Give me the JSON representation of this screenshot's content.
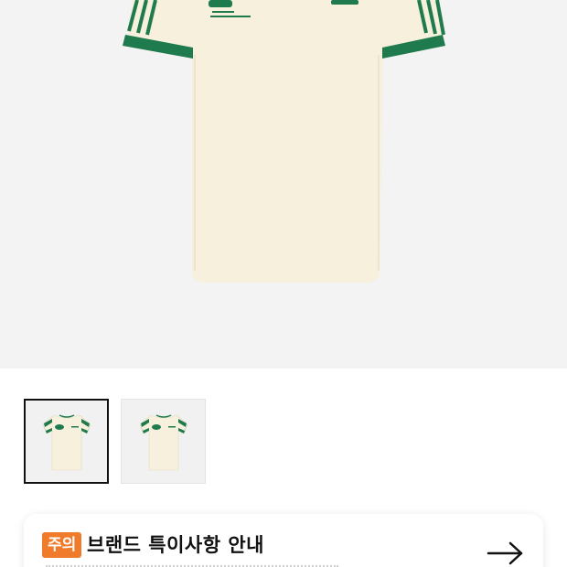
{
  "product": {
    "name": "",
    "colors": {
      "body": "#f6f0dc",
      "trim": "#1f7a4d",
      "background": "#f3f3f3"
    }
  },
  "thumbnails": [
    {
      "selected": true
    },
    {
      "selected": false
    }
  ],
  "notice": {
    "badge": "주의",
    "title": "브랜드 특이사항 안내",
    "badge_color": "#f07b2a",
    "arrow_icon": "arrow-right-icon"
  }
}
